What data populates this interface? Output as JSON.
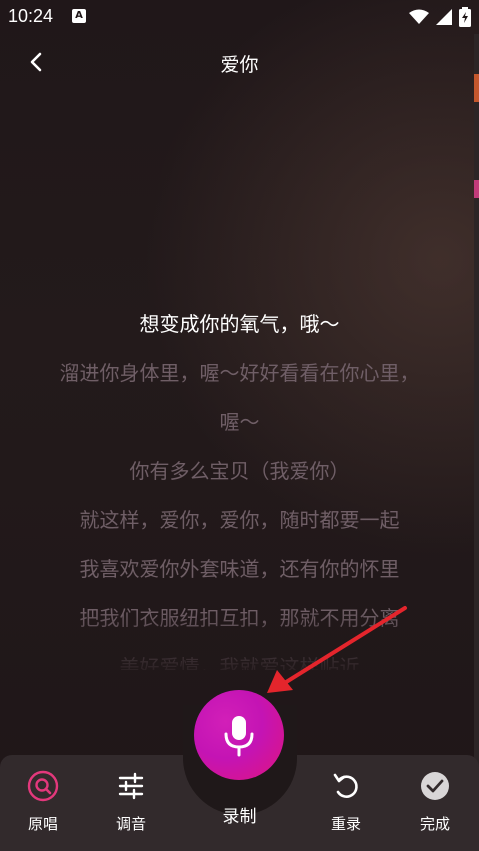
{
  "status_bar": {
    "time": "10:24",
    "notification_glyph": "A"
  },
  "header": {
    "title": "爱你"
  },
  "lyrics": {
    "lines": [
      "想变成你的氧气，哦～",
      "溜进你身体里，喔～好好看看在你心里，",
      "喔～",
      "你有多么宝贝（我爱你）",
      "就这样，爱你，爱你，随时都要一起",
      "我喜欢爱你外套味道，还有你的怀里",
      "把我们衣服纽扣互扣，那就不用分离",
      "美好爱情，我就爱这样贴近"
    ],
    "current_index": 0
  },
  "bottom_bar": {
    "original_label": "原唱",
    "tuning_label": "调音",
    "record_label": "录制",
    "rerecord_label": "重录",
    "done_label": "完成"
  },
  "colors": {
    "accent_mic_start": "#c414b4",
    "accent_mic_end": "#e0157e",
    "original_icon": "#e3387c",
    "annotation_arrow": "#e4252c",
    "lyric_inactive": "#6f5e66",
    "lyric_active": "#ffffff"
  },
  "icons": {
    "back": "chevron-left-icon",
    "original": "search-circle-icon",
    "tuning": "sliders-icon",
    "record": "microphone-icon",
    "rerecord": "refresh-icon",
    "done": "check-circle-icon"
  }
}
